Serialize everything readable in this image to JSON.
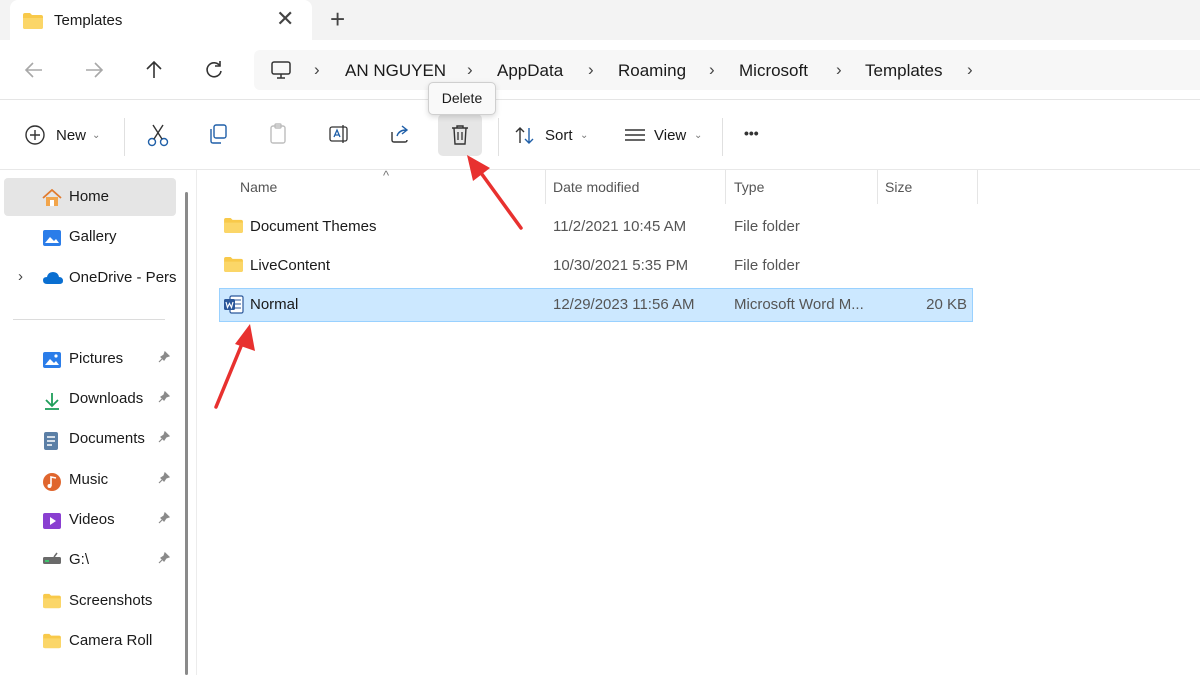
{
  "window": {
    "tab_title": "Templates",
    "tab_close": "✕",
    "tab_add": "+"
  },
  "icons": {
    "back": "arrow-left-icon",
    "forward": "arrow-right-icon",
    "up": "arrow-up-icon",
    "refresh": "refresh-icon",
    "computer": "monitor-icon",
    "folder": "folder-icon",
    "word": "word-document-icon"
  },
  "address": {
    "separator": "›",
    "crumbs": [
      "AN NGUYEN",
      "AppData",
      "Roaming",
      "Microsoft",
      "Templates"
    ]
  },
  "toolbar": {
    "new_label": "New",
    "sort_label": "Sort",
    "view_label": "View",
    "more_label": "•••",
    "chevron": "⌄",
    "delete_tooltip": "Delete"
  },
  "sidebar": {
    "items": [
      {
        "label": "Home",
        "pinned": false
      },
      {
        "label": "Gallery",
        "pinned": false
      },
      {
        "label": "OneDrive - Personal",
        "pinned": false
      },
      {
        "label": "Pictures",
        "pinned": true
      },
      {
        "label": "Downloads",
        "pinned": true
      },
      {
        "label": "Documents",
        "pinned": true
      },
      {
        "label": "Music",
        "pinned": true
      },
      {
        "label": "Videos",
        "pinned": true
      },
      {
        "label": "G:\\",
        "pinned": true
      },
      {
        "label": "Screenshots",
        "pinned": false
      },
      {
        "label": "Camera Roll",
        "pinned": false
      }
    ],
    "expand_glyph": "›",
    "pin_glyph": "📌"
  },
  "list": {
    "columns": [
      "Name",
      "Date modified",
      "Type",
      "Size"
    ],
    "sort_caret": "^",
    "rows": [
      {
        "name": "Document Themes",
        "date": "11/2/2021 10:45 AM",
        "type": "File folder",
        "size": ""
      },
      {
        "name": "LiveContent",
        "date": "10/30/2021 5:35 PM",
        "type": "File folder",
        "size": ""
      },
      {
        "name": "Normal",
        "date": "12/29/2023 11:56 AM",
        "type": "Microsoft Word M...",
        "size": "20 KB"
      }
    ]
  },
  "colors": {
    "accent": "#0067c0",
    "selection": "#cce8ff",
    "folder": "#f8c94a",
    "arrow": "#e8312f"
  }
}
